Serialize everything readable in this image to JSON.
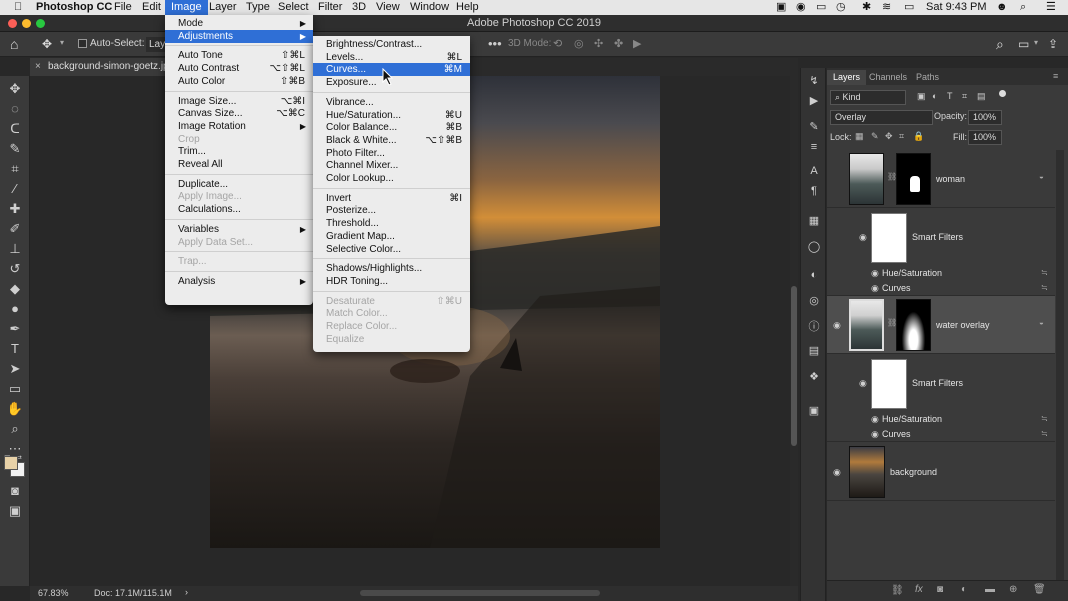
{
  "menubar": {
    "app": "Photoshop CC",
    "items": [
      "File",
      "Edit",
      "Image",
      "Layer",
      "Type",
      "Select",
      "Filter",
      "3D",
      "View",
      "Window",
      "Help"
    ],
    "active": "Image",
    "clock": "Sat 9:43 PM"
  },
  "window": {
    "title": "Adobe Photoshop CC 2019"
  },
  "options": {
    "auto_select": "Auto-Select:",
    "layer_dropdown": "Laye",
    "mode_3d": "3D Mode:"
  },
  "document": {
    "tab": "background-simon-goetz.jpg",
    "zoom": "67.83%",
    "doc_size": "Doc: 17.1M/115.1M"
  },
  "image_menu": {
    "items": [
      {
        "label": "Mode",
        "submenu": true
      },
      {
        "label": "Adjustments",
        "submenu": true,
        "highlight": true
      },
      {
        "sep": true
      },
      {
        "label": "Auto Tone",
        "shortcut": "⇧⌘L"
      },
      {
        "label": "Auto Contrast",
        "shortcut": "⌥⇧⌘L"
      },
      {
        "label": "Auto Color",
        "shortcut": "⇧⌘B"
      },
      {
        "sep": true
      },
      {
        "label": "Image Size...",
        "shortcut": "⌥⌘I"
      },
      {
        "label": "Canvas Size...",
        "shortcut": "⌥⌘C"
      },
      {
        "label": "Image Rotation",
        "submenu": true
      },
      {
        "label": "Crop",
        "disabled": true
      },
      {
        "label": "Trim..."
      },
      {
        "label": "Reveal All"
      },
      {
        "sep": true
      },
      {
        "label": "Duplicate..."
      },
      {
        "label": "Apply Image...",
        "disabled": true
      },
      {
        "label": "Calculations..."
      },
      {
        "sep": true
      },
      {
        "label": "Variables",
        "submenu": true
      },
      {
        "label": "Apply Data Set...",
        "disabled": true
      },
      {
        "sep": true
      },
      {
        "label": "Trap...",
        "disabled": true
      },
      {
        "sep": true
      },
      {
        "label": "Analysis",
        "submenu": true
      }
    ]
  },
  "adjustments_menu": {
    "items": [
      {
        "label": "Brightness/Contrast..."
      },
      {
        "label": "Levels...",
        "shortcut": "⌘L"
      },
      {
        "label": "Curves...",
        "shortcut": "⌘M",
        "highlight": true
      },
      {
        "label": "Exposure..."
      },
      {
        "sep": true
      },
      {
        "label": "Vibrance..."
      },
      {
        "label": "Hue/Saturation...",
        "shortcut": "⌘U"
      },
      {
        "label": "Color Balance...",
        "shortcut": "⌘B"
      },
      {
        "label": "Black & White...",
        "shortcut": "⌥⇧⌘B"
      },
      {
        "label": "Photo Filter..."
      },
      {
        "label": "Channel Mixer..."
      },
      {
        "label": "Color Lookup..."
      },
      {
        "sep": true
      },
      {
        "label": "Invert",
        "shortcut": "⌘I"
      },
      {
        "label": "Posterize..."
      },
      {
        "label": "Threshold..."
      },
      {
        "label": "Gradient Map..."
      },
      {
        "label": "Selective Color..."
      },
      {
        "sep": true
      },
      {
        "label": "Shadows/Highlights..."
      },
      {
        "label": "HDR Toning..."
      },
      {
        "sep": true
      },
      {
        "label": "Desaturate",
        "shortcut": "⇧⌘U",
        "disabled": true
      },
      {
        "label": "Match Color...",
        "disabled": true
      },
      {
        "label": "Replace Color...",
        "disabled": true
      },
      {
        "label": "Equalize",
        "disabled": true
      }
    ]
  },
  "layers_panel": {
    "tabs": [
      "Layers",
      "Channels",
      "Paths"
    ],
    "filter": "Kind",
    "blend_mode": "Overlay",
    "opacity_label": "Opacity:",
    "opacity": "100%",
    "lock_label": "Lock:",
    "fill_label": "Fill:",
    "fill": "100%",
    "layers": [
      {
        "name": "woman",
        "type": "smart"
      },
      {
        "name": "Smart Filters",
        "type": "filters"
      },
      {
        "name": "Hue/Saturation",
        "type": "filter"
      },
      {
        "name": "Curves",
        "type": "filter"
      },
      {
        "name": "water overlay",
        "type": "smart",
        "selected": true
      },
      {
        "name": "Smart Filters",
        "type": "filters"
      },
      {
        "name": "Hue/Saturation",
        "type": "filter"
      },
      {
        "name": "Curves",
        "type": "filter"
      },
      {
        "name": "background",
        "type": "image"
      }
    ]
  }
}
